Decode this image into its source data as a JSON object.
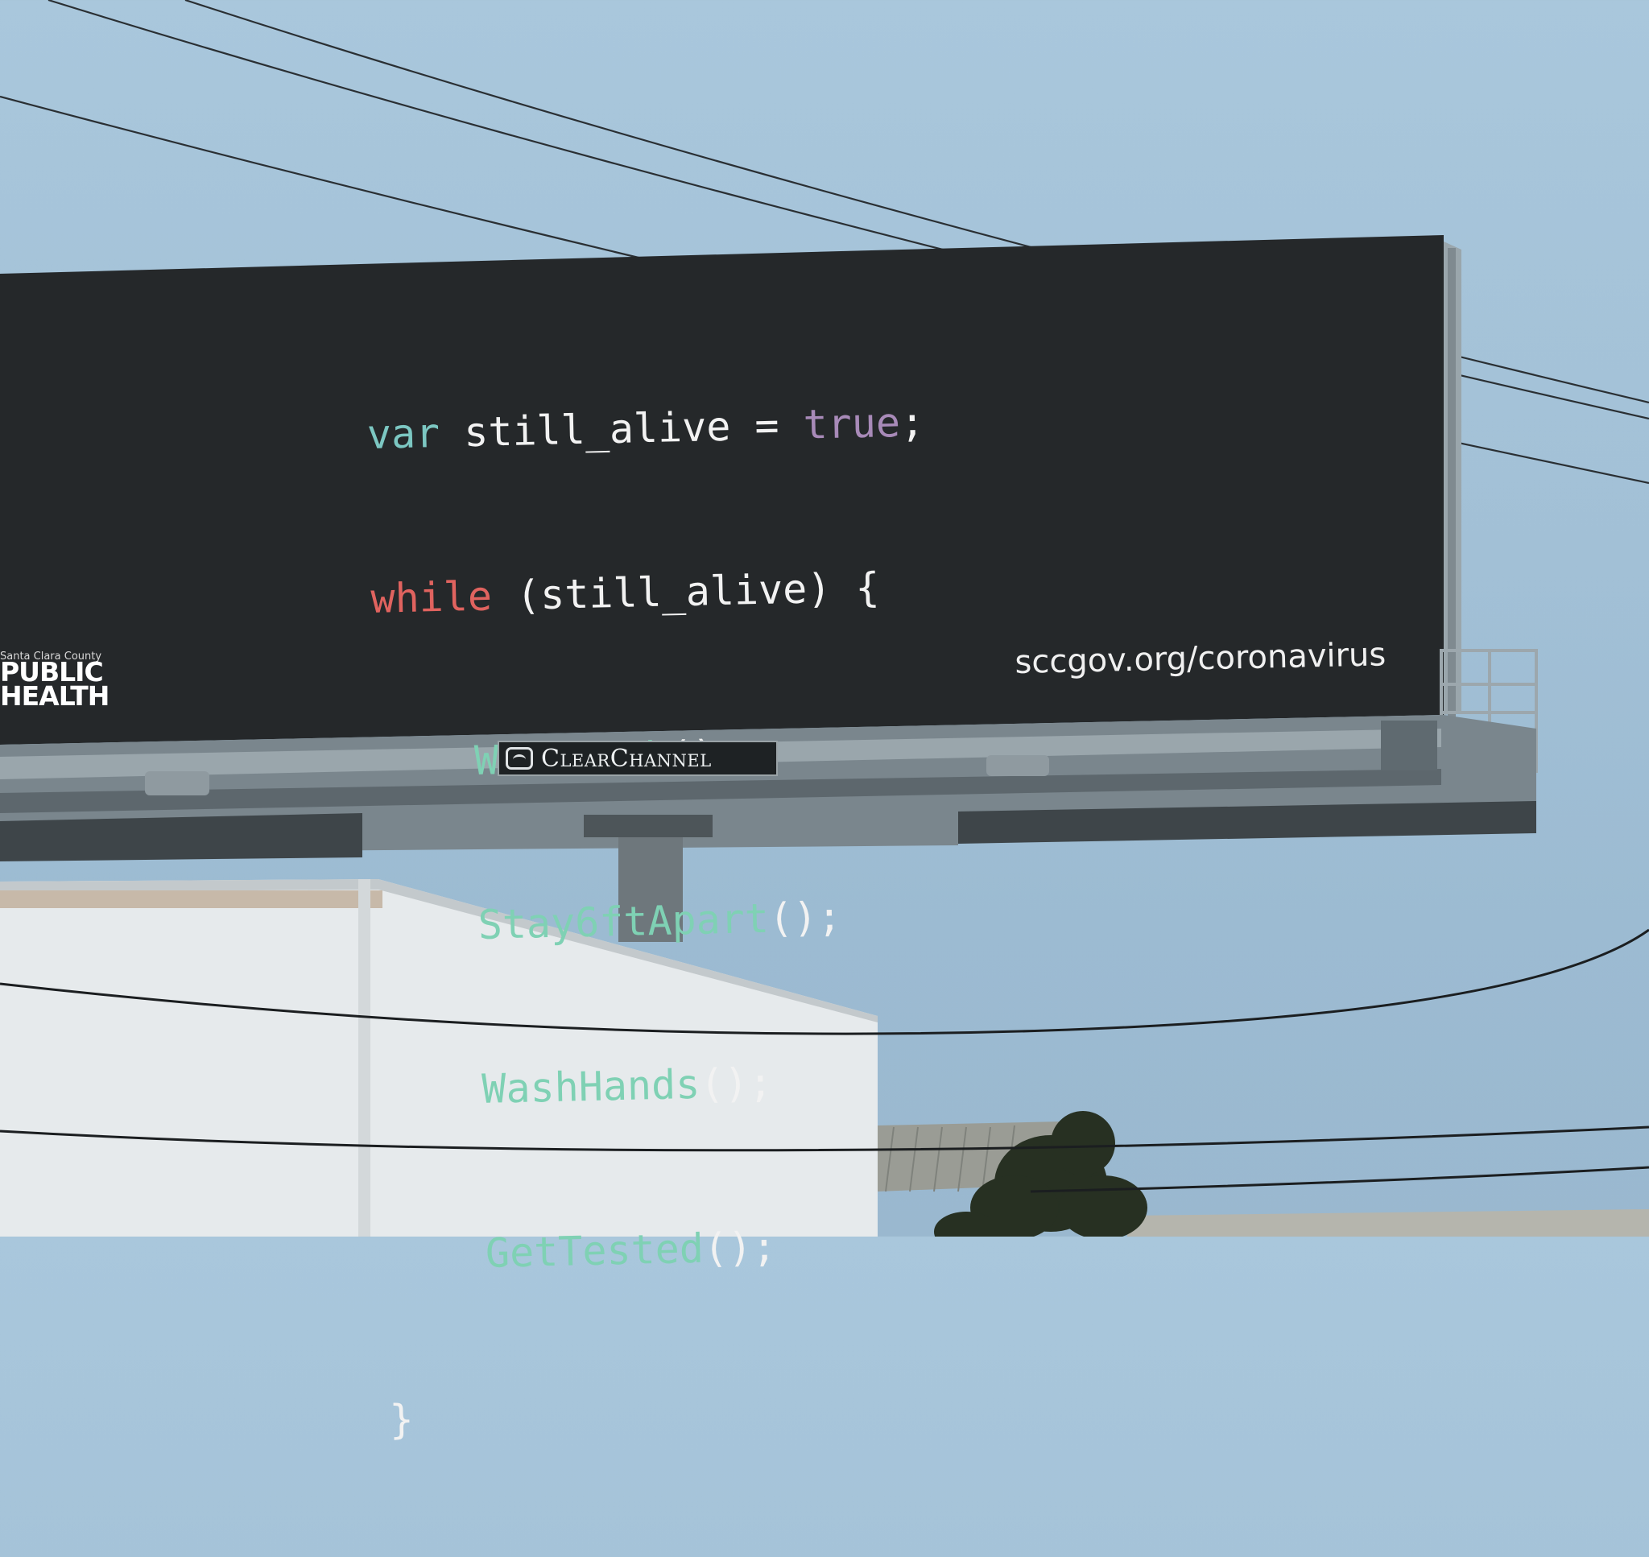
{
  "billboard": {
    "code_lines": {
      "l1_kw": "var",
      "l1_rest": " still_alive = ",
      "l1_val": "true",
      "l1_end": ";",
      "l2_kw": "while",
      "l2_rest": " (still_alive) {",
      "l3_fn": "WearMask",
      "l4_fn": "Stay6ftApart",
      "l5_fn": "WashHands",
      "l6_fn": "GetTested",
      "call_end": "();",
      "close": "}"
    },
    "url": "sccgov.org/coronavirus",
    "logo": {
      "county": "Santa Clara County",
      "line1": "PUBLIC",
      "line2": "HEALTH"
    },
    "operator": "ClearChannel"
  },
  "colors": {
    "sky": "#a6c4d9",
    "panel": "#25282a",
    "keyword_var": "#7cc7c2",
    "keyword_while": "#e0635f",
    "literal_true": "#a88ab8",
    "function": "#7fd1b4"
  }
}
